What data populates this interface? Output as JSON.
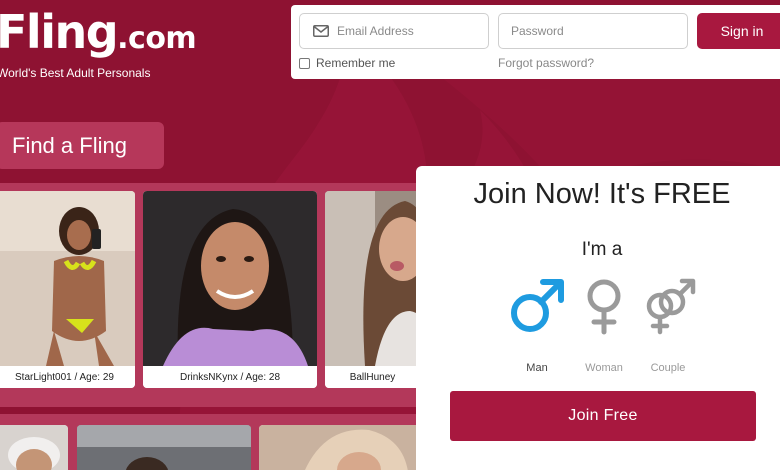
{
  "brand": {
    "logo_main": "Fling",
    "logo_suffix": ".com",
    "tagline": "World's Best Adult Personals"
  },
  "login": {
    "email_placeholder": "Email Address",
    "password_placeholder": "Password",
    "signin_label": "Sign in",
    "remember_label": "Remember me",
    "forgot_label": "Forgot password?"
  },
  "find_label": "Find a Fling",
  "profiles": [
    {
      "caption": "StarLight001 / Age: 29"
    },
    {
      "caption": "DrinksNKynx / Age: 28"
    },
    {
      "caption": "BallHuney"
    }
  ],
  "join": {
    "title": "Join Now! It's FREE",
    "im_a": "I'm a",
    "options": [
      {
        "label": "Man",
        "icon": "male-icon",
        "selected": true
      },
      {
        "label": "Woman",
        "icon": "female-icon",
        "selected": false
      },
      {
        "label": "Couple",
        "icon": "couple-icon",
        "selected": false
      }
    ],
    "button_label": "Join Free"
  },
  "colors": {
    "brand_red": "#a8183f",
    "background": "#8e1232",
    "selected_blue": "#1e9be0",
    "unselected_gray": "#9a9a9a"
  }
}
